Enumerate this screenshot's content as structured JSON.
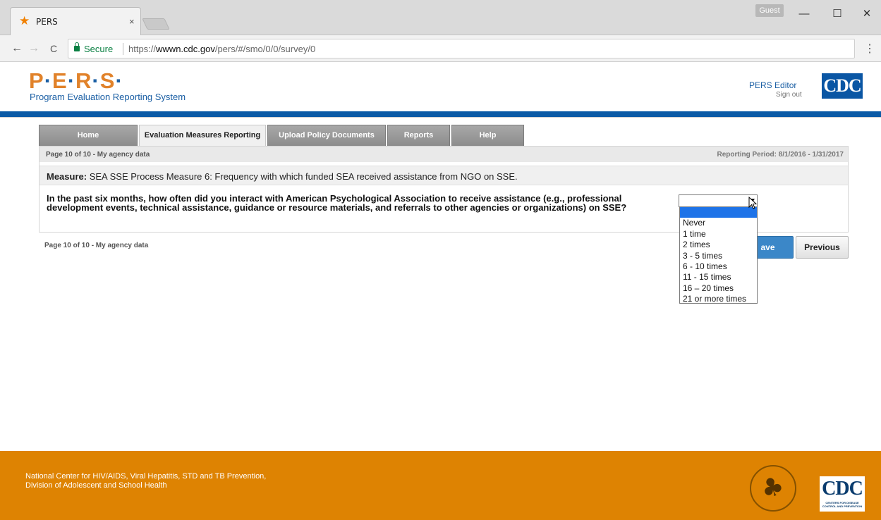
{
  "browser": {
    "tab_title": "PERS",
    "tab_close": "×",
    "guest_label": "Guest",
    "secure_label": "Secure",
    "url_scheme": "https://",
    "url_host": "wwwn.cdc.gov",
    "url_path": "/pers/#/smo/0/0/survey/0",
    "win_min": "—",
    "win_max": "☐",
    "win_close": "✕",
    "back": "←",
    "forward": "→",
    "reload": "C",
    "menu": "⋮"
  },
  "header": {
    "logo_p": "P",
    "logo_e": "E",
    "logo_r": "R",
    "logo_s": "S",
    "logo_dot": "·",
    "subtitle": "Program Evaluation Reporting System",
    "user_name": "PERS Editor",
    "signout": "Sign out",
    "cdc_logo": "CDC"
  },
  "nav": {
    "tabs": [
      {
        "label": "Home"
      },
      {
        "label": "Evaluation Measures Reporting"
      },
      {
        "label": "Upload Policy Documents"
      },
      {
        "label": "Reports"
      },
      {
        "label": "Help"
      }
    ]
  },
  "content": {
    "page_label": "Page 10 of 10 - My agency data",
    "reporting_period": "Reporting Period: 8/1/2016 - 1/31/2017",
    "measure_label": "Measure:",
    "measure_text": " SEA SSE Process Measure 6: Frequency with which funded SEA received assistance from NGO on SSE.",
    "question": "In the past six months, how often did you interact with American Psychological Association to receive assistance (e.g., professional development events, technical assistance, guidance or resource materials, and referrals to other agencies or organizations) on SSE?",
    "page_label_bottom": "Page 10 of 10 - My agency data",
    "save_label": "ave",
    "previous_label": "Previous"
  },
  "dropdown": {
    "selected_value": "",
    "options": [
      "",
      "Never",
      "1 time",
      "2 times",
      "3 - 5 times",
      "6 - 10 times",
      "11 - 15 times",
      "16 – 20 times",
      "21 or more times"
    ]
  },
  "footer": {
    "line1": "National Center for HIV/AIDS, Viral Hepatitis, STD and TB Prevention,",
    "line2": "Division of Adolescent and School Health",
    "cdc_logo": "CDC",
    "cdc_tagline": "CENTERS FOR DISEASE CONTROL AND PREVENTION"
  },
  "colors": {
    "accent_orange": "#de8302",
    "brand_blue": "#0b5aa6",
    "selection_blue": "#1e73e8"
  }
}
